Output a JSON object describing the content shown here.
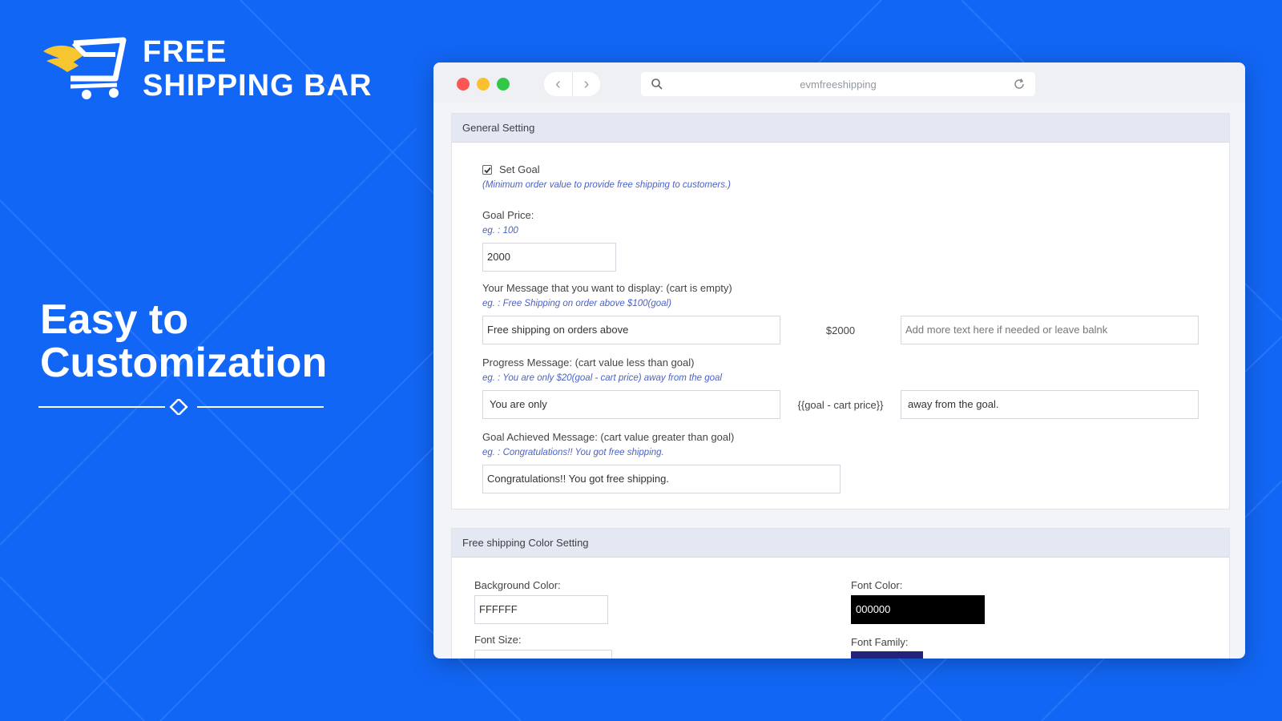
{
  "colors": {
    "background": "#1266f5",
    "accent_yellow": "#f7c52f",
    "font_color_swatch": "#000000",
    "font_family_swatch": "#24217a"
  },
  "logo": {
    "line1": "FREE",
    "line2": "SHIPPING BAR",
    "icon": "shopping-cart-wing-icon"
  },
  "headline": {
    "line1": "Easy to",
    "line2": "Customization"
  },
  "browser": {
    "url": "evmfreeshipping",
    "back_icon": "chevron-left-icon",
    "forward_icon": "chevron-right-icon"
  },
  "general": {
    "title": "General Setting",
    "set_goal": {
      "label": "Set Goal",
      "checked": true,
      "hint": "(Minimum order value to provide free shipping to customers.)"
    },
    "goal_price": {
      "label": "Goal Price:",
      "hint": "eg. : 100",
      "value": "2000"
    },
    "empty_message": {
      "label": "Your Message that you want to display: (cart is empty)",
      "hint": "eg. : Free Shipping on order above $100(goal)",
      "value": "Free shipping on orders above",
      "middle": "$2000",
      "suffix_placeholder": "Add more text here if needed or leave balnk"
    },
    "progress_message": {
      "label": "Progress Message: (cart value less than goal)",
      "hint": "eg. : You are only $20(goal - cart price) away from the goal",
      "value": "You are only",
      "middle": "{{goal - cart price}}",
      "suffix_value": "away from the goal."
    },
    "achieved_message": {
      "label": "Goal Achieved Message: (cart value greater than goal)",
      "hint": "eg. : Congratulations!! You got free shipping.",
      "value": "Congratulations!! You got free shipping."
    }
  },
  "color_setting": {
    "title": "Free shipping Color Setting",
    "background_color": {
      "label": "Background Color:",
      "value": "FFFFFF"
    },
    "font_color": {
      "label": "Font Color:",
      "value": "000000"
    },
    "font_size": {
      "label": "Font Size:"
    },
    "font_family": {
      "label": "Font Family:"
    }
  }
}
